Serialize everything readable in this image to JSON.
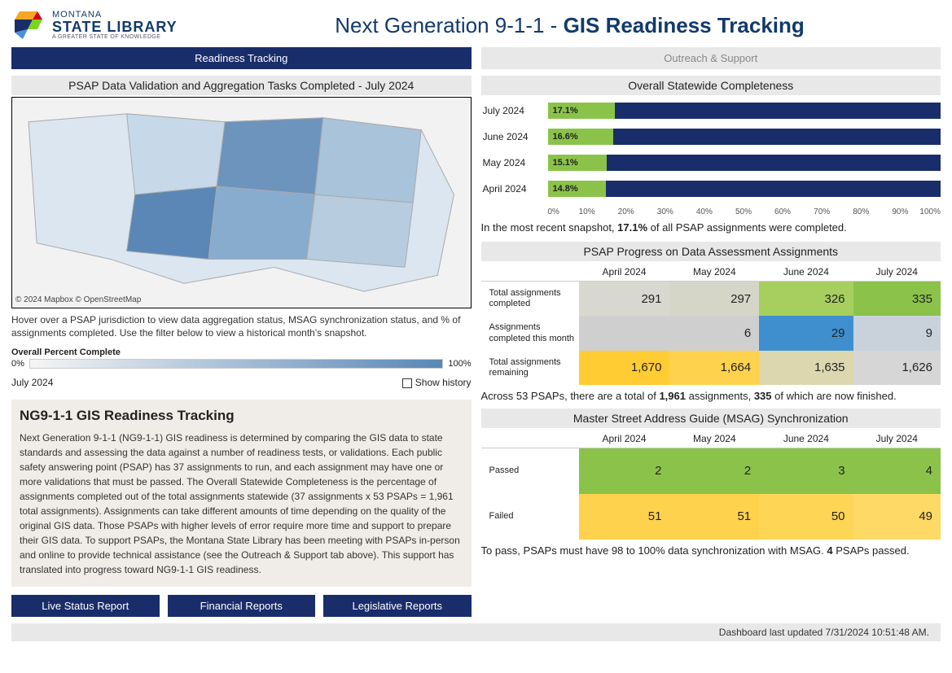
{
  "brand": {
    "l1": "MONTANA",
    "l2": "STATE LIBRARY",
    "l3": "A GREATER STATE OF KNOWLEDGE"
  },
  "title_prefix": "Next Generation 9-1-1 - ",
  "title_bold": "GIS Readiness Tracking",
  "tabs": {
    "active": "Readiness Tracking",
    "inactive": "Outreach & Support"
  },
  "map": {
    "title": "PSAP Data Validation and Aggregation Tasks Completed - July 2024",
    "attr": "© 2024 Mapbox © OpenStreetMap",
    "hover": "Hover over a PSAP jurisdiction to view data aggregation status, MSAG synchronization status, and % of assignments completed. Use the filter below to view a historical month's snapshot.",
    "legend_title": "Overall Percent Complete",
    "legend_min": "0%",
    "legend_max": "100%",
    "month_label": "July 2024",
    "show_history": "Show history"
  },
  "readiness": {
    "heading": "NG9-1-1 GIS Readiness Tracking",
    "body": "Next Generation 9-1-1 (NG9-1-1) GIS readiness is determined by comparing the GIS data to state standards and assessing the data against a number of readiness tests, or validations. Each public safety answering point (PSAP) has 37 assignments to run, and each assignment may have one or more validations that must be passed. The Overall Statewide Completeness is the percentage of assignments completed out of the total assignments statewide (37 assignments x 53 PSAPs = 1,961 total assignments). Assignments can take different amounts of time depending on the quality of the original GIS data. Those PSAPs with higher levels of error require more time and support to prepare their GIS data. To support PSAPs, the Montana State Library has been meeting with PSAPs in-person and online to provide technical assistance (see the Outreach & Support tab above).  This support has translated into progress toward NG9-1-1 GIS readiness."
  },
  "buttons": {
    "b1": "Live Status Report",
    "b2": "Financial Reports",
    "b3": "Legislative Reports"
  },
  "completeness": {
    "title": "Overall Statewide Completeness",
    "rows": [
      {
        "label": "July 2024",
        "pct": 17.1,
        "pct_label": "17.1%"
      },
      {
        "label": "June 2024",
        "pct": 16.6,
        "pct_label": "16.6%"
      },
      {
        "label": "May 2024",
        "pct": 15.1,
        "pct_label": "15.1%"
      },
      {
        "label": "April 2024",
        "pct": 14.8,
        "pct_label": "14.8%"
      }
    ],
    "axis": [
      "0%",
      "10%",
      "20%",
      "30%",
      "40%",
      "50%",
      "60%",
      "70%",
      "80%",
      "90%",
      "100%"
    ],
    "snapshot_prefix": "In the most recent snapshot, ",
    "snapshot_value": "17.1%",
    "snapshot_suffix": " of all PSAP assignments were completed."
  },
  "progress": {
    "title": "PSAP Progress on Data Assessment Assignments",
    "cols": [
      "April 2024",
      "May 2024",
      "June 2024",
      "July 2024"
    ],
    "rows": [
      {
        "label": "Total assignments completed",
        "v": [
          "291",
          "297",
          "326",
          "335"
        ],
        "bg": [
          "#d8d8d0",
          "#d6d6c8",
          "#a7cf5f",
          "#8bc34a"
        ]
      },
      {
        "label": "Assignments completed this month",
        "v": [
          "",
          "6",
          "29",
          "9"
        ],
        "bg": [
          "#cfcfcf",
          "#cfcfcf",
          "#3f8fcf",
          "#c9d2db"
        ]
      },
      {
        "label": "Total assignments remaining",
        "v": [
          "1,670",
          "1,664",
          "1,635",
          "1,626"
        ],
        "bg": [
          "#ffcc33",
          "#ffd24d",
          "#ddd7b0",
          "#d6d6d6"
        ]
      }
    ],
    "footer_a": "Across 53 PSAPs, there are a total of ",
    "footer_b": "1,961",
    "footer_c": " assignments, ",
    "footer_d": "335",
    "footer_e": " of which are now finished."
  },
  "msag": {
    "title": "Master Street Address Guide (MSAG) Synchronization",
    "cols": [
      "April 2024",
      "May 2024",
      "June 2024",
      "July 2024"
    ],
    "rows": [
      {
        "label": "Passed",
        "v": [
          "2",
          "2",
          "3",
          "4"
        ],
        "bg": [
          "#8bc34a",
          "#8bc34a",
          "#8bc34a",
          "#8bc34a"
        ]
      },
      {
        "label": "Failed",
        "v": [
          "51",
          "51",
          "50",
          "49"
        ],
        "bg": [
          "#ffd24d",
          "#ffd24d",
          "#ffd556",
          "#ffd966"
        ]
      }
    ],
    "footer_a": "To pass, PSAPs must have 98 to 100% data synchronization with MSAG. ",
    "footer_b": "4",
    "footer_c": " PSAPs passed."
  },
  "last_updated": "Dashboard last updated 7/31/2024 10:51:48 AM.",
  "chart_data": {
    "completeness_bars": {
      "type": "bar",
      "orientation": "horizontal",
      "categories": [
        "July 2024",
        "June 2024",
        "May 2024",
        "April 2024"
      ],
      "values": [
        17.1,
        16.6,
        15.1,
        14.8
      ],
      "xlabel": "",
      "ylabel": "",
      "xlim": [
        0,
        100
      ],
      "unit": "%"
    },
    "progress_table": {
      "type": "table",
      "columns": [
        "April 2024",
        "May 2024",
        "June 2024",
        "July 2024"
      ],
      "rows": {
        "Total assignments completed": [
          291,
          297,
          326,
          335
        ],
        "Assignments completed this month": [
          null,
          6,
          29,
          9
        ],
        "Total assignments remaining": [
          1670,
          1664,
          1635,
          1626
        ]
      }
    },
    "msag_table": {
      "type": "table",
      "columns": [
        "April 2024",
        "May 2024",
        "June 2024",
        "July 2024"
      ],
      "rows": {
        "Passed": [
          2,
          2,
          3,
          4
        ],
        "Failed": [
          51,
          51,
          50,
          49
        ]
      }
    }
  }
}
